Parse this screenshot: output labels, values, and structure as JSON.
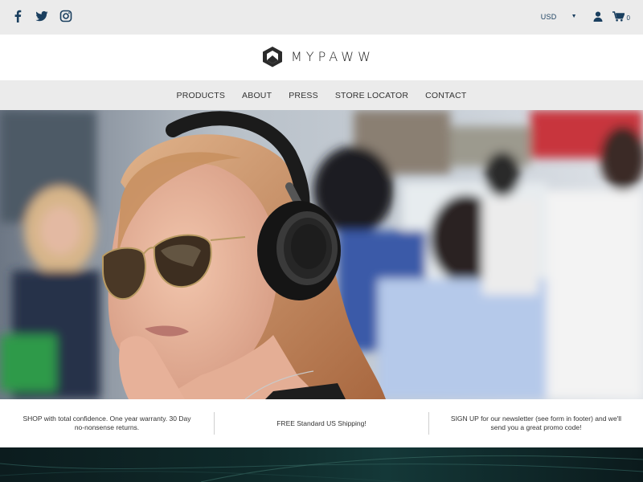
{
  "topbar": {
    "social": [
      {
        "name": "facebook-icon"
      },
      {
        "name": "twitter-icon"
      },
      {
        "name": "instagram-icon"
      }
    ],
    "currency": "USD",
    "cart_count": "0",
    "icon_color": "#1a3f5f"
  },
  "logo": {
    "text": "MYPAWW"
  },
  "nav": {
    "items": [
      "PRODUCTS",
      "ABOUT",
      "PRESS",
      "STORE LOCATOR",
      "CONTACT"
    ]
  },
  "benefits": [
    "SHOP with total confidence. One year warranty. 30 Day no-nonsense returns.",
    "FREE Standard US Shipping!",
    "SIGN UP for our newsletter (see form in footer) and we'll send you a great promo code!"
  ],
  "colors": {
    "topbar_bg": "#ebebeb",
    "nav_bg": "#ebebeb",
    "footer_dark": "#0f2a2a"
  }
}
